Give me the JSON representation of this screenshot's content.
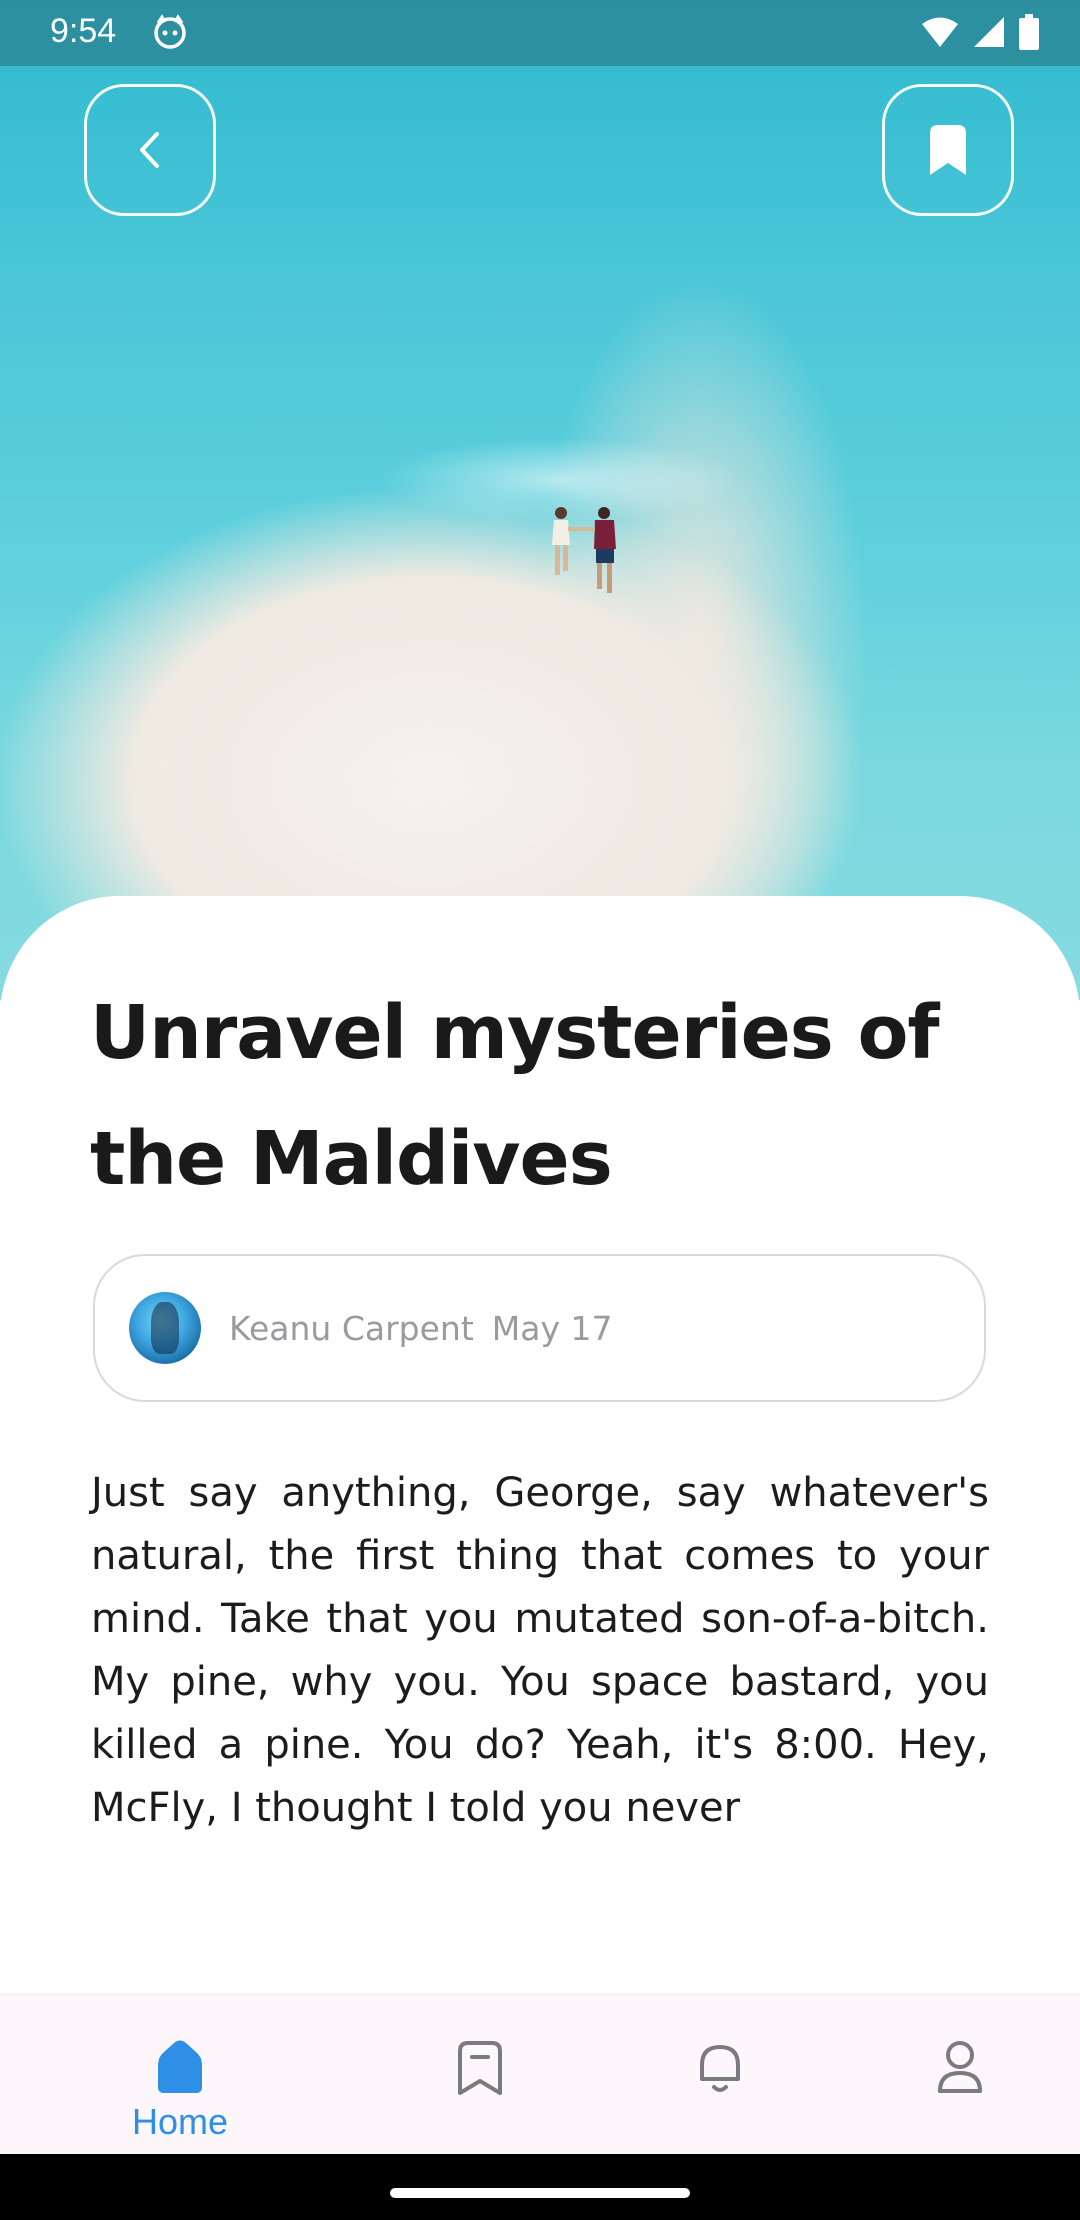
{
  "status_bar": {
    "time": "9:54",
    "app_icon": "cat-face-icon",
    "icons": [
      "wifi-icon",
      "cell-signal-icon",
      "battery-icon"
    ]
  },
  "hero": {
    "back_icon": "chevron-left-icon",
    "bookmark_icon": "bookmark-icon"
  },
  "article": {
    "title": "Unravel mysteries of the Maldives",
    "author": "Keanu Carpent",
    "date": "May 17",
    "body": "Just say anything, George, say whatever's natural, the first thing that comes to your mind. Take that you mutated son-of-a-bitch. My pine, why you. You space bastard, you killed a pine. You do? Yeah, it's 8:00. Hey, McFly, I thought I told you never"
  },
  "bottom_nav": {
    "items": [
      {
        "label": "Home",
        "icon": "home-icon",
        "active": true
      },
      {
        "label": "",
        "icon": "bookmark-icon",
        "active": false
      },
      {
        "label": "",
        "icon": "bell-icon",
        "active": false
      },
      {
        "label": "",
        "icon": "profile-icon",
        "active": false
      }
    ]
  },
  "colors": {
    "accent": "#2f8ee6",
    "title": "#1a1a1a",
    "muted": "#9a9aa0"
  }
}
